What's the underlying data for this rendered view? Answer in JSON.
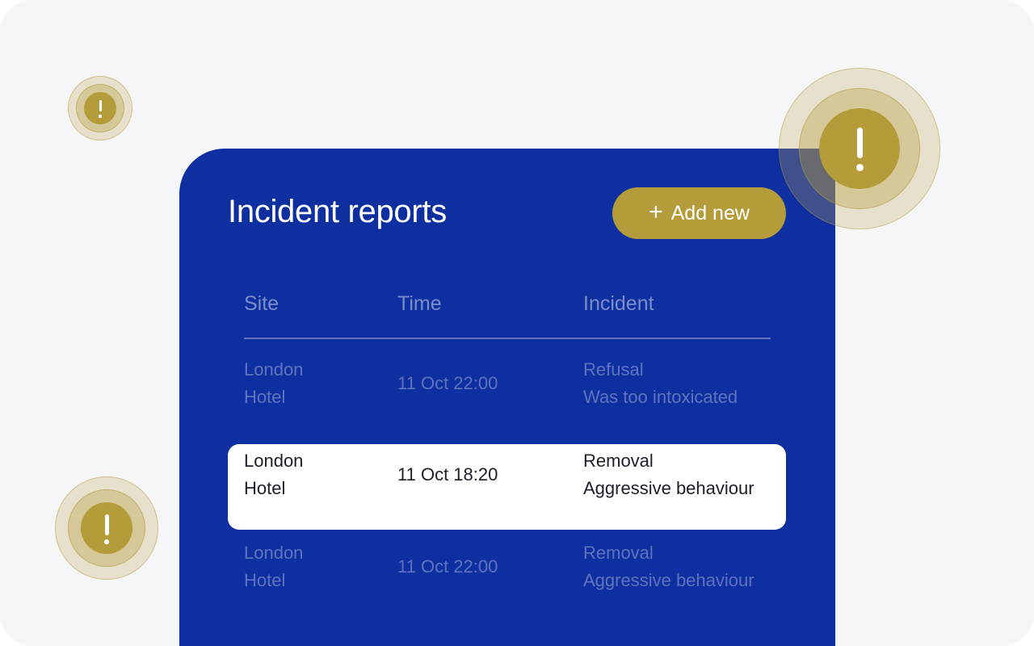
{
  "card": {
    "title": "Incident reports",
    "add_button_label": "Add new"
  },
  "table": {
    "headers": [
      "Site",
      "Time",
      "Incident"
    ],
    "rows": [
      {
        "site_line1": "London",
        "site_line2": "Hotel",
        "time": "11 Oct 22:00",
        "incident_type": "Refusal",
        "incident_detail": "Was too intoxicated",
        "selected": false
      },
      {
        "site_line1": "London",
        "site_line2": "Hotel",
        "time": "11 Oct 18:20",
        "incident_type": "Removal",
        "incident_detail": "Aggressive behaviour",
        "selected": true
      },
      {
        "site_line1": "London",
        "site_line2": "Hotel",
        "time": "11 Oct 22:00",
        "incident_type": "Removal",
        "incident_detail": "Aggressive behaviour",
        "selected": false
      }
    ]
  },
  "colors": {
    "background": "#f5f6f8",
    "card": "#0d2f9f",
    "accent_gold": "#b59c3a",
    "selected_row": "#ffffff"
  },
  "icons": {
    "alert": "exclamation-alert-icon",
    "add": "plus-icon"
  }
}
